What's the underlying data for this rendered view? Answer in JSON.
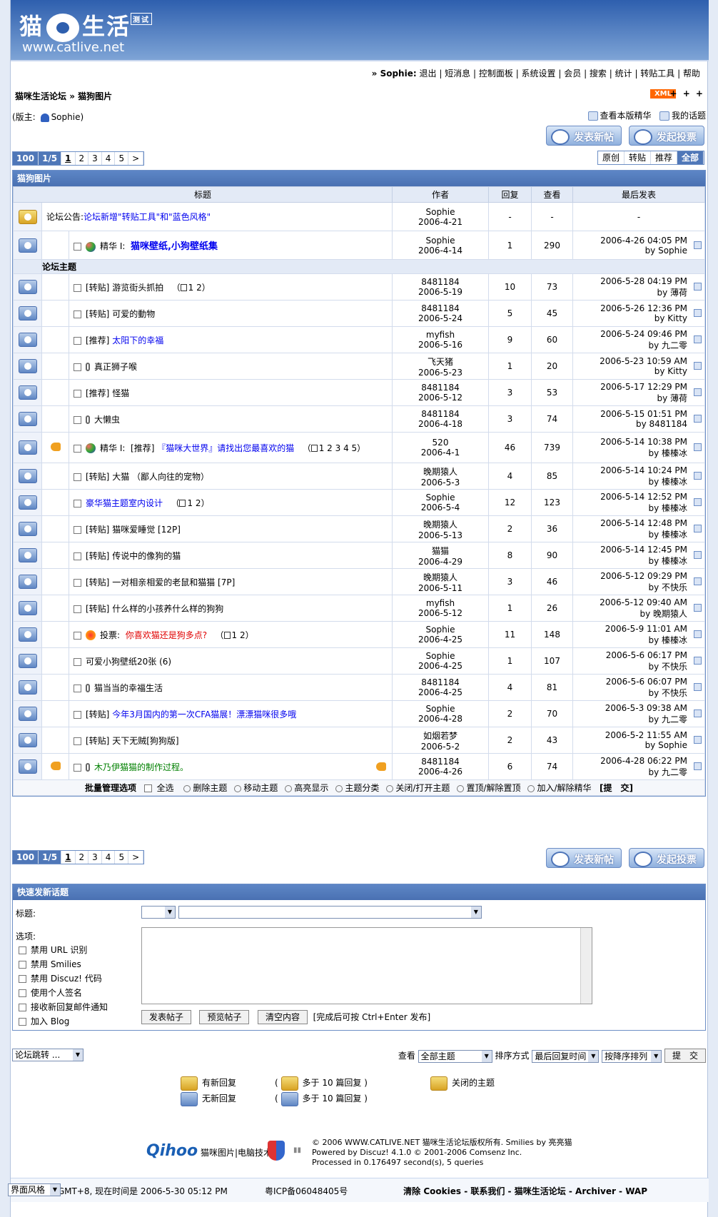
{
  "header": {
    "logo_text": "猫生活",
    "logo_badge": "测试",
    "site_url": "www.catlive.net"
  },
  "topnav": {
    "prefix": "»",
    "user": "Sophie:",
    "items": [
      "退出",
      "短消息",
      "控制面板",
      "系统设置",
      "会员",
      "搜索",
      "统计",
      "转贴工具",
      "帮助"
    ]
  },
  "breadcrumb": {
    "forum": "猫咪生活论坛",
    "sep": "»",
    "board": "猫狗图片"
  },
  "xml_badge": "XML",
  "more_dots": "+ + +",
  "moderator": {
    "label": "(版主:",
    "name": "Sophie",
    "close": ")"
  },
  "links": {
    "digest": "查看本版精华",
    "mytopics": "我的话题"
  },
  "buttons": {
    "new_post": "发表新帖",
    "new_poll": "发起投票"
  },
  "pager": {
    "total": "100",
    "pages": "1/5",
    "nums": [
      "1",
      "2",
      "3",
      "4",
      "5"
    ],
    "next": ">"
  },
  "filters": [
    "原创",
    "转贴",
    "推荐",
    "全部"
  ],
  "table": {
    "title": "猫狗图片",
    "headers": [
      "标题",
      "作者",
      "回复",
      "查看",
      "最后发表"
    ],
    "section_label": "论坛主题",
    "announce": {
      "prefix": "论坛公告:",
      "text": "论坛新增\"转贴工具\"和\"蓝色风格\"",
      "author": "Sophie",
      "date": "2006-4-21",
      "replies": "-",
      "views": "-",
      "last": "-"
    },
    "digest": {
      "prefix": "精华 I:",
      "text": "猫咪壁纸,小狗壁纸集",
      "author": "Sophie",
      "date": "2006-4-14",
      "replies": "1",
      "views": "290",
      "last_time": "2006-4-26 04:05 PM",
      "last_by": "by Sophie"
    },
    "rows": [
      {
        "tag": "[转贴]",
        "text": "游览街头抓拍",
        "pages": "1 2",
        "author": "8481184",
        "date": "2006-5-19",
        "replies": "10",
        "views": "73",
        "last_time": "2006-5-28 04:19 PM",
        "last_by": "by 薄荷"
      },
      {
        "tag": "[转贴]",
        "text": "可爱的動物",
        "author": "8481184",
        "date": "2006-5-24",
        "replies": "5",
        "views": "45",
        "last_time": "2006-5-26 12:36 PM",
        "last_by": "by Kitty"
      },
      {
        "tag": "[推荐]",
        "text": "太阳下的幸福",
        "color": "blue",
        "author": "myfish",
        "date": "2006-5-16",
        "replies": "9",
        "views": "60",
        "last_time": "2006-5-24 09:46 PM",
        "last_by": "by 九二零"
      },
      {
        "clip": true,
        "text": "真正狮子喉",
        "author": "飞天猪",
        "date": "2006-5-23",
        "replies": "1",
        "views": "20",
        "last_time": "2006-5-23 10:59 AM",
        "last_by": "by Kitty"
      },
      {
        "tag": "[推荐]",
        "text": "怪猫",
        "author": "8481184",
        "date": "2006-5-12",
        "replies": "3",
        "views": "53",
        "last_time": "2006-5-17 12:29 PM",
        "last_by": "by 薄荷"
      },
      {
        "clip": true,
        "text": "大懒虫",
        "author": "8481184",
        "date": "2006-4-18",
        "replies": "3",
        "views": "74",
        "last_time": "2006-5-15 01:51 PM",
        "last_by": "by 8481184"
      },
      {
        "hot": true,
        "gem": true,
        "prefix": "精华 I:",
        "tag": "[推荐]",
        "text": "『猫咪大世界』请找出您最喜欢的猫",
        "color": "blue",
        "pages": "1 2 3 4 5",
        "author": "520",
        "date": "2006-4-1",
        "replies": "46",
        "views": "739",
        "last_time": "2006-5-14 10:38 PM",
        "last_by": "by 榛榛冰"
      },
      {
        "tag": "[转贴]",
        "text": "大猫 （鄙人向往的宠物）",
        "author": "晚期猿人",
        "date": "2006-5-3",
        "replies": "4",
        "views": "85",
        "last_time": "2006-5-14 10:24 PM",
        "last_by": "by 榛榛冰"
      },
      {
        "text": "豪华猫主题室内设计",
        "color": "blue",
        "pages": "1 2",
        "author": "Sophie",
        "date": "2006-5-4",
        "replies": "12",
        "views": "123",
        "last_time": "2006-5-14 12:52 PM",
        "last_by": "by 榛榛冰"
      },
      {
        "tag": "[转贴]",
        "text": "猫咪爱睡觉 [12P]",
        "author": "晚期猿人",
        "date": "2006-5-13",
        "replies": "2",
        "views": "36",
        "last_time": "2006-5-14 12:48 PM",
        "last_by": "by 榛榛冰"
      },
      {
        "tag": "[转贴]",
        "text": "传说中的像狗的猫",
        "author": "猫猫",
        "date": "2006-4-29",
        "replies": "8",
        "views": "90",
        "last_time": "2006-5-14 12:45 PM",
        "last_by": "by 榛榛冰"
      },
      {
        "tag": "[转贴]",
        "text": "一对相亲相爱的老鼠和猫猫 [7P]",
        "author": "晚期猿人",
        "date": "2006-5-11",
        "replies": "3",
        "views": "46",
        "last_time": "2006-5-12 09:29 PM",
        "last_by": "by 不快乐"
      },
      {
        "tag": "[转贴]",
        "text": "什么样的小孩养什么样的狗狗",
        "author": "myfish",
        "date": "2006-5-12",
        "replies": "1",
        "views": "26",
        "last_time": "2006-5-12 09:40 AM",
        "last_by": "by 晚期猿人"
      },
      {
        "poll": true,
        "prefix": "投票:",
        "text": "你喜欢猫还是狗多点?",
        "color": "red",
        "pages": "1 2",
        "author": "Sophie",
        "date": "2006-4-25",
        "replies": "11",
        "views": "148",
        "last_time": "2006-5-9 11:01 AM",
        "last_by": "by 榛榛冰"
      },
      {
        "text": "可爱小狗壁纸20张 (6)",
        "author": "Sophie",
        "date": "2006-4-25",
        "replies": "1",
        "views": "107",
        "last_time": "2006-5-6 06:17 PM",
        "last_by": "by 不快乐"
      },
      {
        "clip": true,
        "text": "猫当当的幸福生活",
        "author": "8481184",
        "date": "2006-4-25",
        "replies": "4",
        "views": "81",
        "last_time": "2006-5-6 06:07 PM",
        "last_by": "by 不快乐"
      },
      {
        "tag": "[转贴]",
        "text": "今年3月国内的第一次CFA猫展！漂漂猫咪很多哦",
        "color": "blue",
        "author": "Sophie",
        "date": "2006-4-28",
        "replies": "2",
        "views": "70",
        "last_time": "2006-5-3 09:38 AM",
        "last_by": "by 九二零"
      },
      {
        "tag": "[转贴]",
        "text": "天下无贼[狗狗版]",
        "author": "如烟若梦",
        "date": "2006-5-2",
        "replies": "2",
        "views": "43",
        "last_time": "2006-5-2 11:55 AM",
        "last_by": "by Sophie"
      },
      {
        "hot": true,
        "clip": true,
        "thumb": true,
        "text": "木乃伊猫猫的制作过程。",
        "color": "green",
        "author": "8481184",
        "date": "2006-4-26",
        "replies": "6",
        "views": "74",
        "last_time": "2006-4-28 06:22 PM",
        "last_by": "by 九二零"
      }
    ],
    "batch": {
      "label": "批量管理选项",
      "check_all": "全选",
      "options": [
        "删除主题",
        "移动主题",
        "高亮显示",
        "主题分类",
        "关闭/打开主题",
        "置顶/解除置顶",
        "加入/解除精华"
      ],
      "submit": "[提　交]"
    }
  },
  "quick": {
    "title": "快速发新话题",
    "subject_label": "标题:",
    "options_label": "选项:",
    "options": [
      "禁用 URL 识别",
      "禁用 Smilies",
      "禁用 Discuz! 代码",
      "使用个人签名",
      "接收新回复邮件通知",
      "加入 Blog"
    ],
    "buttons": [
      "发表帖子",
      "预览帖子",
      "清空内容"
    ],
    "hint": "[完成后可按 Ctrl+Enter 发布]"
  },
  "bottom": {
    "jump": "论坛跳转 ...",
    "view_label": "查看",
    "view_value": "全部主题",
    "sort_label": "排序方式",
    "sort_value": "最后回复时间",
    "order_value": "按降序排列",
    "submit": "提　交"
  },
  "legend": {
    "new": "有新回复",
    "nonew": "无新回复",
    "hot_new": "多于 10 篇回复",
    "hot_nonew": "多于 10 篇回复",
    "closed": "关闭的主题",
    "open_paren": "(",
    "close_paren": ")"
  },
  "footer": {
    "sponsor": "Qihoo",
    "sponsor_text": "猫咪图片|电脑技术",
    "copy1": "© 2006 WWW.CATLIVE.NET 猫咪生活论坛版权所有. Smilies by 亮亮猫",
    "copy2": "Powered by Discuz! 4.1.0 © 2001-2006 Comsenz Inc.",
    "copy3": "Processed in 0.176497 second(s), 5 queries",
    "timezone": "所有时间为 GMT+8, 现在时间是 2006-5-30 05:12 PM",
    "icp": "粤ICP备06048405号",
    "links": "清除 Cookies - 联系我们 - 猫咪生活论坛 - Archiver - WAP",
    "style": "界面风格"
  }
}
